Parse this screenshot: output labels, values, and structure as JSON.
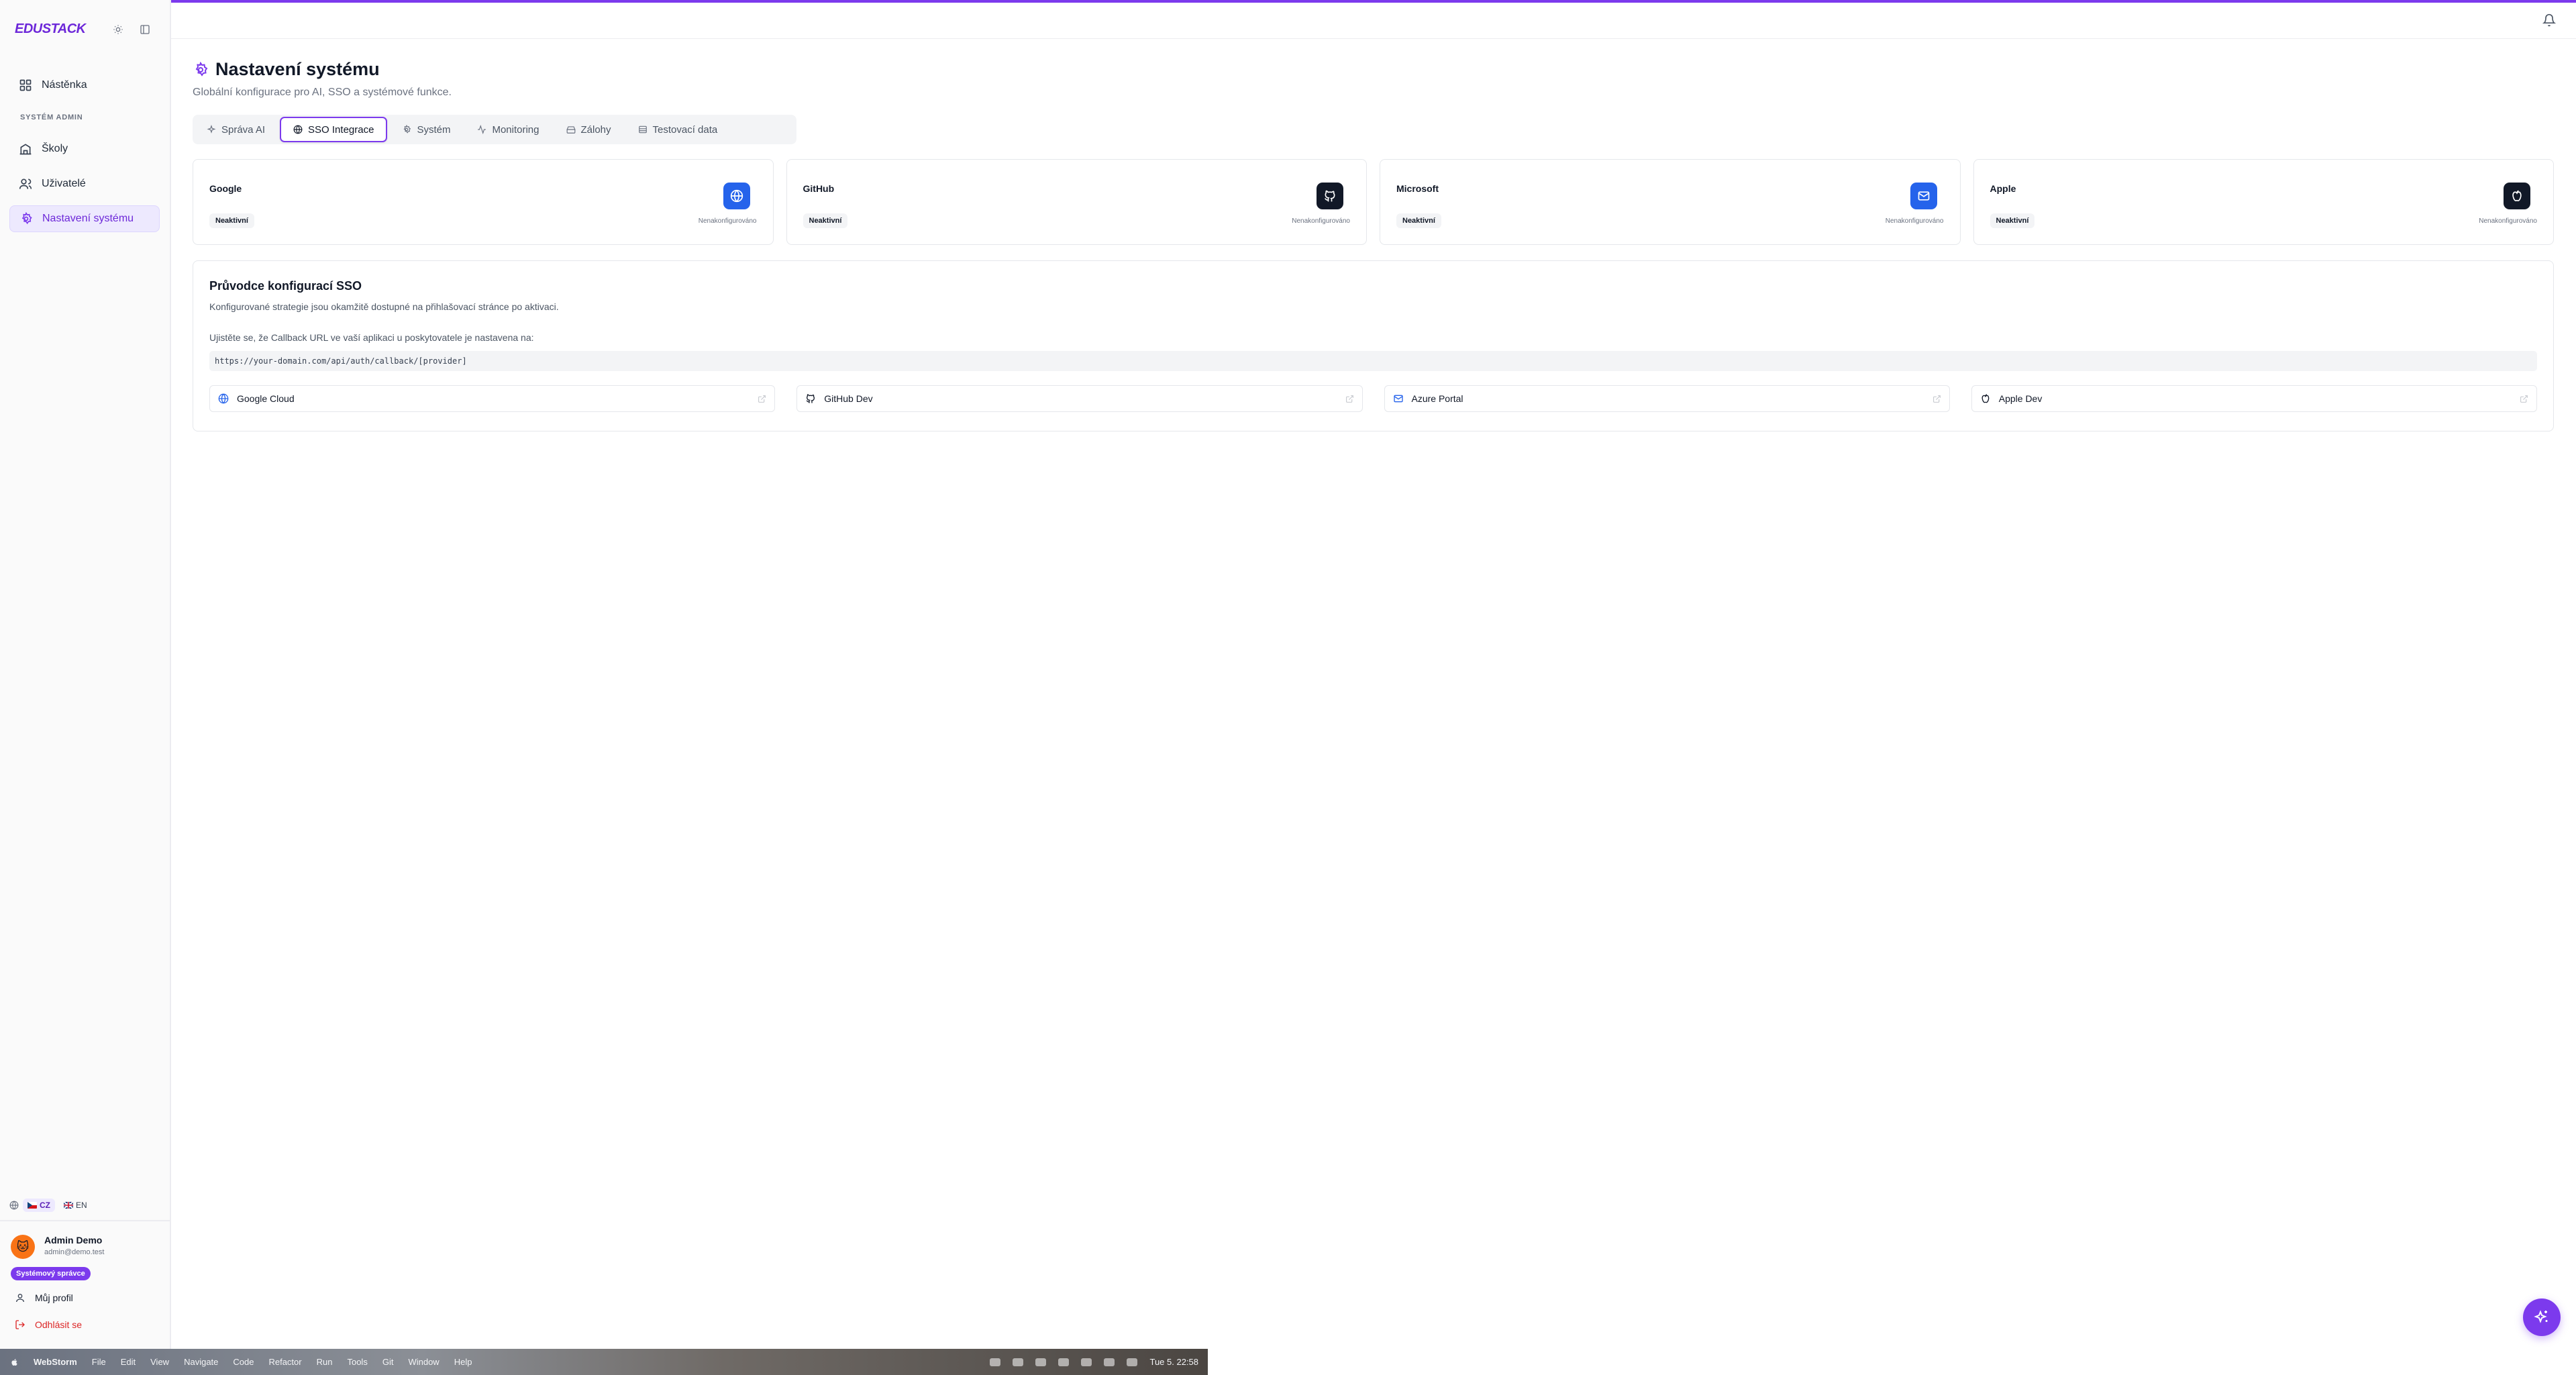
{
  "brand": {
    "name": "EDUSTACK"
  },
  "sidebar": {
    "items": [
      {
        "label": "Nástěnka",
        "icon": "dashboard-icon"
      },
      {
        "label": "Školy",
        "icon": "school-icon"
      },
      {
        "label": "Uživatelé",
        "icon": "users-icon"
      },
      {
        "label": "Nastavení systému",
        "icon": "settings-icon",
        "active": true
      }
    ],
    "section_label": "SYSTÉM ADMIN",
    "languages": [
      {
        "code": "CZ",
        "active": true
      },
      {
        "code": "EN",
        "active": false
      }
    ]
  },
  "user": {
    "name": "Admin Demo",
    "email": "admin@demo.test",
    "role": "Systémový správce",
    "profile_label": "Můj profil",
    "logout_label": "Odhlásit se"
  },
  "page": {
    "title": "Nastavení systému",
    "subtitle": "Globální konfigurace pro AI, SSO a systémové funkce."
  },
  "tabs": [
    {
      "label": "Správa AI",
      "icon": "sparkle-icon"
    },
    {
      "label": "SSO Integrace",
      "icon": "globe-icon",
      "active": true
    },
    {
      "label": "Systém",
      "icon": "gear-icon"
    },
    {
      "label": "Monitoring",
      "icon": "activity-icon"
    },
    {
      "label": "Zálohy",
      "icon": "archive-icon"
    },
    {
      "label": "Testovací data",
      "icon": "database-icon"
    }
  ],
  "providers": [
    {
      "name": "Google",
      "status": "Neaktivní",
      "state": "Nenakonfigurováno",
      "icon": "globe-icon",
      "color": "#2563eb"
    },
    {
      "name": "GitHub",
      "status": "Neaktivní",
      "state": "Nenakonfigurováno",
      "icon": "github-icon",
      "color": "#111827"
    },
    {
      "name": "Microsoft",
      "status": "Neaktivní",
      "state": "Nenakonfigurováno",
      "icon": "mail-icon",
      "color": "#2563eb"
    },
    {
      "name": "Apple",
      "status": "Neaktivní",
      "state": "Nenakonfigurováno",
      "icon": "apple-icon",
      "color": "#111827"
    }
  ],
  "guide": {
    "title": "Průvodce konfigurací SSO",
    "description": "Konfigurované strategie jsou okamžitě dostupné na přihlašovací stránce po aktivaci.",
    "note": "Ujistěte se, že Callback URL ve vaší aplikaci u poskytovatele je nastavena na:",
    "callback_url": "https://your-domain.com/api/auth/callback/[provider]",
    "links": [
      {
        "label": "Google Cloud",
        "icon": "globe-icon"
      },
      {
        "label": "GitHub Dev",
        "icon": "github-icon"
      },
      {
        "label": "Azure Portal",
        "icon": "mail-icon"
      },
      {
        "label": "Apple Dev",
        "icon": "apple-icon"
      }
    ]
  },
  "menubar": {
    "app": "WebStorm",
    "items": [
      "File",
      "Edit",
      "View",
      "Navigate",
      "Code",
      "Refactor",
      "Run",
      "Tools",
      "Git",
      "Window",
      "Help"
    ],
    "clock": "Tue 5. 22:58"
  },
  "colors": {
    "accent": "#7c3aed",
    "accent_light": "#ede9fe",
    "danger": "#dc2626"
  }
}
